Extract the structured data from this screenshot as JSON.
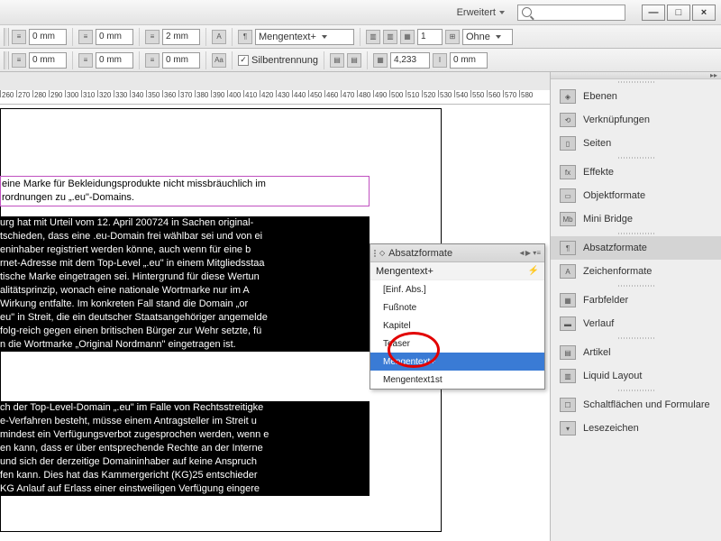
{
  "title_bar": {
    "workspace": "Erweitert"
  },
  "toolbar": {
    "row1": {
      "left_indent": "0 mm",
      "right_indent": "0 mm",
      "first_line": "2 mm",
      "style_select": "Mengentext+",
      "columns": "1",
      "column_bridge": "Ohne"
    },
    "row2": {
      "v1": "0 mm",
      "v2": "0 mm",
      "v3": "0 mm",
      "hyphenation_label": "Silbentrennung",
      "h_value": "4,233",
      "baseline": "0 mm"
    }
  },
  "ruler_ticks": [
    "260",
    "270",
    "280",
    "290",
    "300",
    "310",
    "320",
    "330",
    "340",
    "350",
    "360",
    "370",
    "380",
    "390",
    "400",
    "410",
    "420",
    "430",
    "440",
    "450",
    "460",
    "470",
    "480",
    "490",
    "500",
    "510",
    "520",
    "530",
    "540",
    "550",
    "560",
    "570",
    "580"
  ],
  "doc": {
    "purple_l1": "eine Marke für Bekleidungsprodukte nicht missbräuchlich im",
    "purple_l2": "rordnungen zu „.eu\"-Domains.",
    "selected_block1": [
      "urg hat mit Urteil vom 12. April 200724 in Sachen original-",
      "tschieden, dass eine .eu-Domain frei wählbar sei und von ei",
      "eninhaber registriert werden könne, auch wenn für eine b",
      "rnet-Adresse mit dem Top-Level „.eu\" in einem Mitgliedsstaa",
      "tische Marke eingetragen sei. Hintergrund für diese Wertun",
      "alitätsprinzip, wonach eine nationale Wortmarke nur im A",
      "Wirkung entfalte. Im konkreten Fall stand die Domain „or",
      "eu\" in Streit, die ein deutscher Staatsangehöriger angemelde",
      "folg-reich gegen einen britischen Bürger zur Wehr setzte, fü",
      "n die Wortmarke „Original Nordmann\" eingetragen ist."
    ],
    "selected_block2": [
      "ch der Top-Level-Domain „.eu\" im Falle von Rechtsstreitigke",
      "e-Verfahren besteht, müsse einem Antragsteller im Streit u",
      "mindest ein Verfügungsverbot zugesprochen werden, wenn e",
      "en kann, dass er über entsprechende Rechte an der Interne",
      "und sich der derzeitige Domaininhaber auf keine Anspruch",
      "fen kann. Dies hat das Kammergericht (KG)25 entschieder",
      "KG Anlauf auf Erlass einer einstweiligen Verfügung eingere"
    ]
  },
  "style_panel": {
    "title": "Absatzformate",
    "current": "Mengentext+",
    "items": [
      {
        "label": "[Einf. Abs.]",
        "selected": false
      },
      {
        "label": "Fußnote",
        "selected": false
      },
      {
        "label": "Kapitel",
        "selected": false
      },
      {
        "label": "Teaser",
        "selected": false
      },
      {
        "label": "Mengentext+",
        "selected": true
      },
      {
        "label": "Mengentext1st",
        "selected": false
      }
    ]
  },
  "dock": {
    "groups": [
      [
        {
          "id": "ebenen",
          "label": "Ebenen"
        },
        {
          "id": "verknuepfungen",
          "label": "Verknüpfungen"
        },
        {
          "id": "seiten",
          "label": "Seiten"
        }
      ],
      [
        {
          "id": "effekte",
          "label": "Effekte"
        },
        {
          "id": "objektformate",
          "label": "Objektformate"
        },
        {
          "id": "minibridge",
          "label": "Mini Bridge"
        }
      ],
      [
        {
          "id": "absatzformate",
          "label": "Absatzformate",
          "active": true
        },
        {
          "id": "zeichenformate",
          "label": "Zeichenformate"
        }
      ],
      [
        {
          "id": "farbfelder",
          "label": "Farbfelder"
        },
        {
          "id": "verlauf",
          "label": "Verlauf"
        }
      ],
      [
        {
          "id": "artikel",
          "label": "Artikel"
        },
        {
          "id": "liquidlayout",
          "label": "Liquid Layout"
        }
      ],
      [
        {
          "id": "schaltflaechen",
          "label": "Schaltflächen und Formulare"
        },
        {
          "id": "lesezeichen",
          "label": "Lesezeichen"
        }
      ]
    ]
  }
}
